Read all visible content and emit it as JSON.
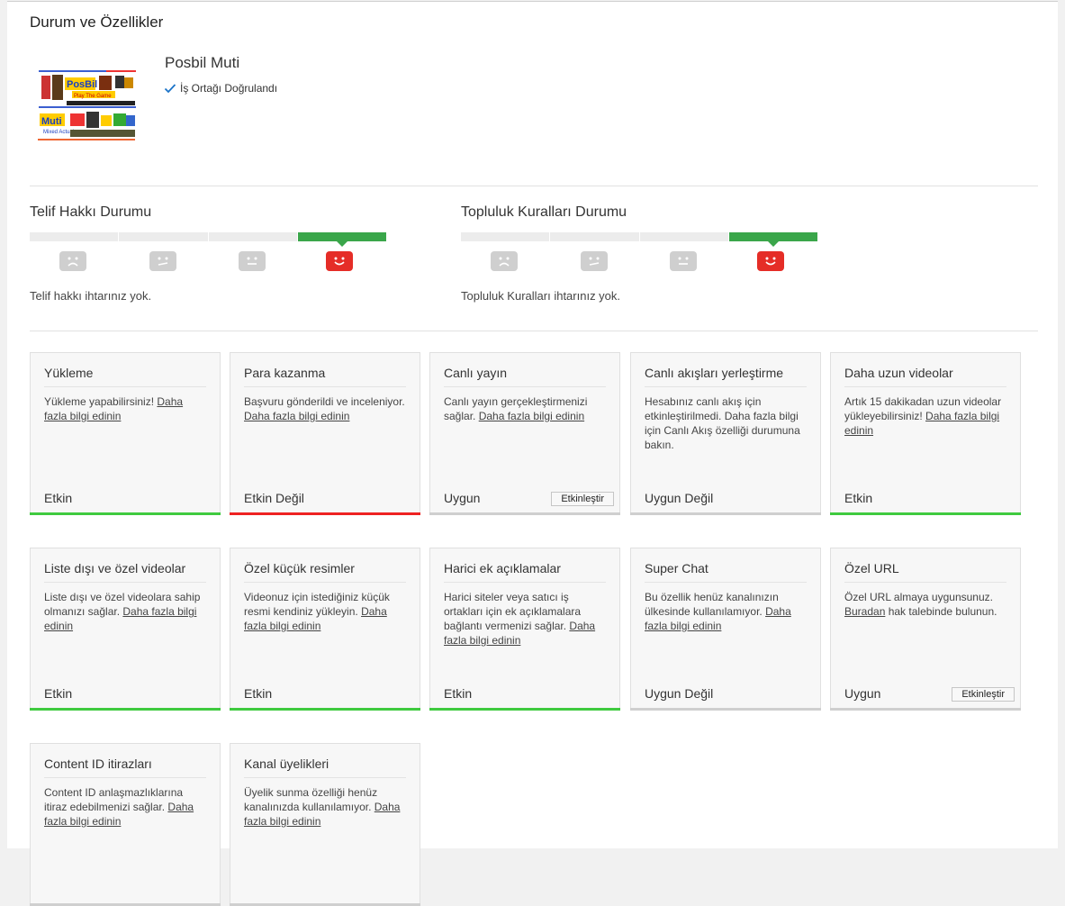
{
  "page": {
    "title": "Durum ve Özellikler"
  },
  "channel": {
    "name": "Posbil Muti",
    "verified_label": "İş Ortağı Doğrulandı",
    "thumb_text_1": "PosBil",
    "thumb_text_2": "Play The Game",
    "thumb_text_3": "Muti",
    "thumb_text_4": "Mixed Actual"
  },
  "copyright": {
    "title": "Telif Hakkı Durumu",
    "text": "Telif hakkı ihtarınız yok."
  },
  "community": {
    "title": "Topluluk Kuralları Durumu",
    "text": "Topluluk Kuralları ihtarınız yok."
  },
  "colors": {
    "green": "#3fca3f",
    "red": "#ee2222",
    "meter_active": "#3aa64a",
    "face_active": "#e52d27"
  },
  "cards": [
    {
      "title": "Yükleme",
      "desc": "Yükleme yapabilirsiniz! ",
      "link": "Daha fazla bilgi edinin",
      "desc_after": "",
      "status": "Etkin",
      "button": "",
      "bar": "green"
    },
    {
      "title": "Para kazanma",
      "desc": "Başvuru gönderildi ve inceleniyor. ",
      "link": "Daha fazla bilgi edinin",
      "desc_after": "",
      "status": "Etkin Değil",
      "button": "",
      "bar": "red"
    },
    {
      "title": "Canlı yayın",
      "desc": "Canlı yayın gerçekleştirmenizi sağlar. ",
      "link": "Daha fazla bilgi edinin",
      "desc_after": "",
      "status": "Uygun",
      "button": "Etkinleştir",
      "bar": "gray"
    },
    {
      "title": "Canlı akışları yerleştirme",
      "desc": "Hesabınız canlı akış için etkinleştirilmedi. Daha fazla bilgi için Canlı Akış özelliği durumuna bakın.",
      "link": "",
      "desc_after": "",
      "status": "Uygun Değil",
      "button": "",
      "bar": "gray"
    },
    {
      "title": "Daha uzun videolar",
      "desc": "Artık 15 dakikadan uzun videolar yükleyebilirsiniz! ",
      "link": "Daha fazla bilgi edinin",
      "desc_after": "",
      "status": "Etkin",
      "button": "",
      "bar": "green"
    },
    {
      "title": "Liste dışı ve özel videolar",
      "desc": "Liste dışı ve özel videolara sahip olmanızı sağlar. ",
      "link": "Daha fazla bilgi edinin",
      "desc_after": "",
      "status": "Etkin",
      "button": "",
      "bar": "green"
    },
    {
      "title": "Özel küçük resimler",
      "desc": "Videonuz için istediğiniz küçük resmi kendiniz yükleyin. ",
      "link": "Daha fazla bilgi edinin",
      "desc_after": "",
      "status": "Etkin",
      "button": "",
      "bar": "green"
    },
    {
      "title": "Harici ek açıklamalar",
      "desc": "Harici siteler veya satıcı iş ortakları için ek açıklamalara bağlantı vermenizi sağlar. ",
      "link": "Daha fazla bilgi edinin",
      "desc_after": "",
      "status": "Etkin",
      "button": "",
      "bar": "green"
    },
    {
      "title": "Super Chat",
      "desc": "Bu özellik henüz kanalınızın ülkesinde kullanılamıyor. ",
      "link": "Daha fazla bilgi edinin",
      "desc_after": "",
      "status": "Uygun Değil",
      "button": "",
      "bar": "gray"
    },
    {
      "title": "Özel URL",
      "desc": "Özel URL almaya uygunsunuz. ",
      "link": "Buradan",
      "desc_after": " hak talebinde bulunun.",
      "status": "Uygun",
      "button": "Etkinleştir",
      "bar": "gray"
    },
    {
      "title": "Content ID itirazları",
      "desc": "Content ID anlaşmazlıklarına itiraz edebilmenizi sağlar. ",
      "link": "Daha fazla bilgi edinin",
      "desc_after": "",
      "status": "",
      "button": "",
      "bar": "gray"
    },
    {
      "title": "Kanal üyelikleri",
      "desc": "Üyelik sunma özelliği henüz kanalınızda kullanılamıyor. ",
      "link": "Daha fazla bilgi edinin",
      "desc_after": "",
      "status": "",
      "button": "",
      "bar": "gray"
    }
  ]
}
